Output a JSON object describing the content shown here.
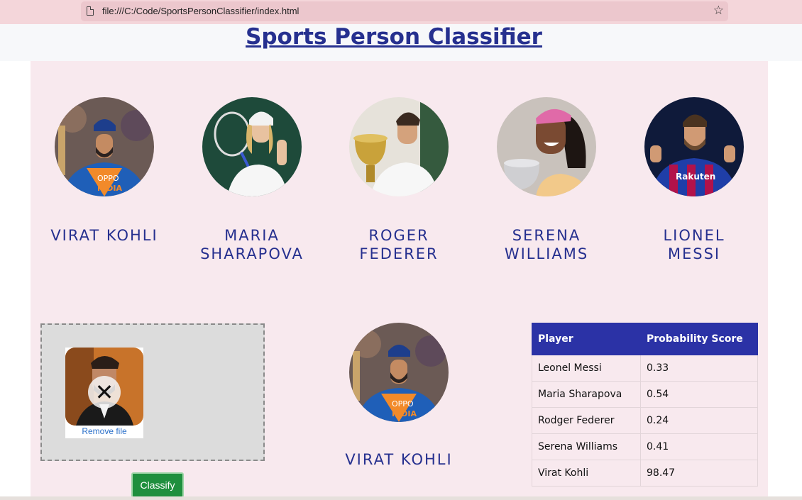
{
  "browser": {
    "url": "file:///C:/Code/SportsPersonClassifier/index.html",
    "star_icon": "bookmark-star-icon"
  },
  "page": {
    "title": "Sports Person Classifier"
  },
  "players": [
    {
      "name": "VIRAT KOHLI",
      "photo": "virat-kohli-photo"
    },
    {
      "name": "MARIA\nSHARAPOVA",
      "photo": "maria-sharapova-photo"
    },
    {
      "name": "ROGER\nFEDERER",
      "photo": "roger-federer-photo"
    },
    {
      "name": "SERENA\nWILLIAMS",
      "photo": "serena-williams-photo"
    },
    {
      "name": "LIONEL\nMESSI",
      "photo": "lionel-messi-photo"
    }
  ],
  "upload": {
    "remove_label": "Remove file",
    "remove_icon": "close-x-icon",
    "classify_label": "Classify"
  },
  "result": {
    "name": "VIRAT KOHLI"
  },
  "table": {
    "headers": [
      "Player",
      "Probability Score"
    ],
    "rows": [
      [
        "Leonel Messi",
        "0.33"
      ],
      [
        "Maria Sharapova",
        "0.54"
      ],
      [
        "Rodger Federer",
        "0.24"
      ],
      [
        "Serena Williams",
        "0.41"
      ],
      [
        "Virat Kohli",
        "98.47"
      ]
    ]
  },
  "colors": {
    "accent": "#26308f",
    "table_header": "#2b32a6",
    "panel_bg": "#f8e9ee",
    "button": "#1f8f3e"
  }
}
